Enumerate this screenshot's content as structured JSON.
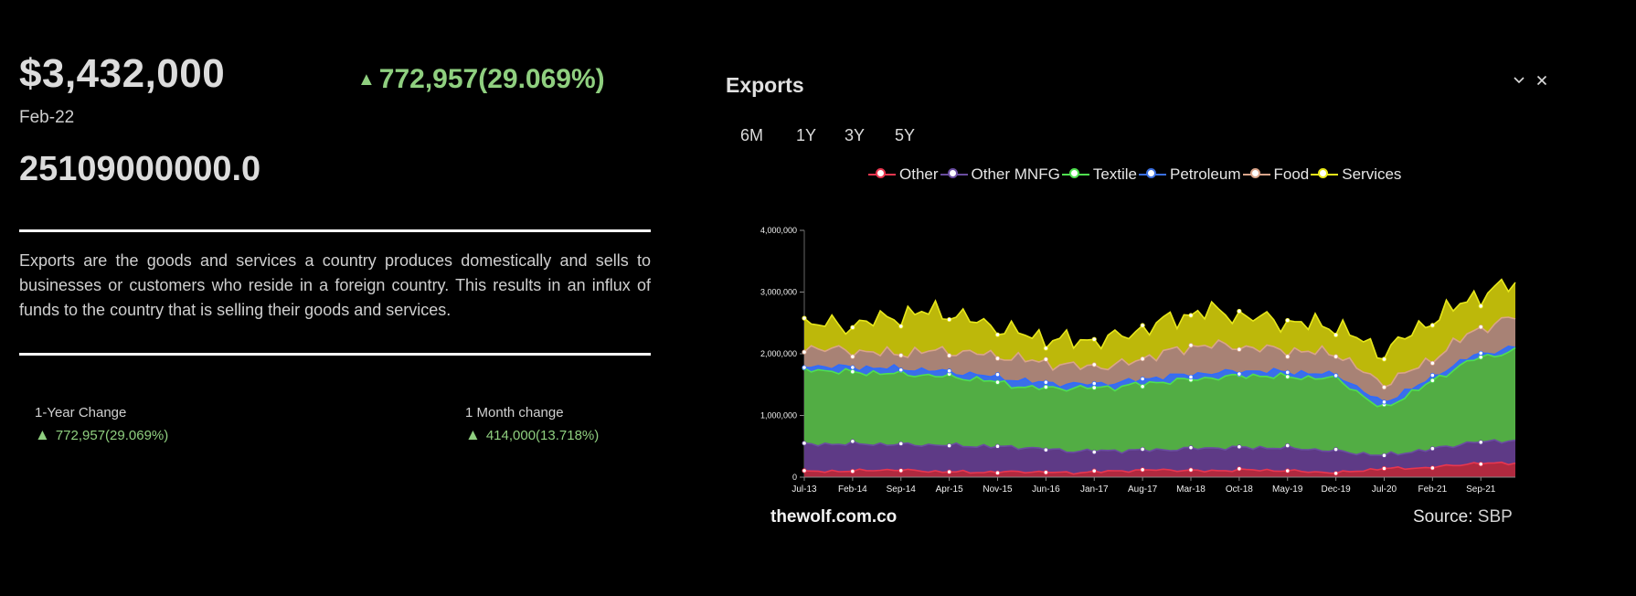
{
  "header": {
    "price": "$3,432,000",
    "change_arrow": "▲",
    "change_text": "772,957(29.069%)",
    "date": "Feb-22",
    "total": "25109000000.0"
  },
  "description": "Exports are the goods and services a country produces domestically and sells to businesses or customers who reside in a foreign country. This results in an influx of funds to the country that is selling their goods and services.",
  "stats": [
    {
      "label": "1-Year Change",
      "arrow": "▲",
      "value": "772,957(29.069%)"
    },
    {
      "label": "1 Month change",
      "arrow": "▲",
      "value": "414,000(13.718%)"
    }
  ],
  "panel": {
    "title": "Exports",
    "icons": [
      "chevron-down-icon",
      "close-icon"
    ],
    "ranges": [
      "6M",
      "1Y",
      "3Y",
      "5Y"
    ],
    "brand": "thewolf.com.co",
    "source_label": "Source:",
    "source_value": "SBP"
  },
  "legend": [
    {
      "name": "Other",
      "color": "#e8364f"
    },
    {
      "name": "Other MNFG",
      "color": "#6a4da0"
    },
    {
      "name": "Textile",
      "color": "#4fe04f"
    },
    {
      "name": "Petroleum",
      "color": "#3a6fe0"
    },
    {
      "name": "Food",
      "color": "#d9a48a"
    },
    {
      "name": "Services",
      "color": "#e8e81a"
    }
  ],
  "chart_data": {
    "type": "area",
    "stacked": true,
    "ylim": [
      0,
      4000000
    ],
    "yticks": [
      0,
      1000000,
      2000000,
      3000000,
      4000000
    ],
    "ytick_labels": [
      "0",
      "1,000,000",
      "2,000,000",
      "3,000,000",
      "4,000,000"
    ],
    "xtick_labels": [
      "Jul-13",
      "Feb-14",
      "Sep-14",
      "Apr-15",
      "Nov-15",
      "Jun-16",
      "Jan-17",
      "Aug-17",
      "Mar-18",
      "Oct-18",
      "May-19",
      "Dec-19",
      "Jul-20",
      "Feb-21",
      "Sep-21"
    ],
    "xtick_index": [
      0,
      7,
      14,
      21,
      28,
      35,
      42,
      49,
      56,
      63,
      70,
      77,
      84,
      91,
      98
    ],
    "x_start": "Jul-13",
    "x_end": "Feb-22",
    "n_points": 104,
    "cumulative_anchors": [
      {
        "name": "Other",
        "values": [
          90000,
          100000,
          120000,
          90000,
          80000,
          90000,
          70000,
          100000,
          120000,
          100000,
          120000,
          100000,
          70000,
          140000,
          150000,
          220000,
          230000
        ]
      },
      {
        "name": "Other MNFG",
        "values": [
          530000,
          540000,
          530000,
          520000,
          500000,
          480000,
          420000,
          430000,
          440000,
          470000,
          480000,
          470000,
          420000,
          350000,
          440000,
          560000,
          600000
        ]
      },
      {
        "name": "Textile",
        "values": [
          1750000,
          1700000,
          1680000,
          1640000,
          1580000,
          1450000,
          1440000,
          1460000,
          1540000,
          1600000,
          1650000,
          1620000,
          1600000,
          1100000,
          1500000,
          1900000,
          2050000
        ]
      },
      {
        "name": "Petroleum",
        "values": [
          1800000,
          1780000,
          1760000,
          1720000,
          1650000,
          1550000,
          1500000,
          1520000,
          1620000,
          1680000,
          1720000,
          1700000,
          1650000,
          1200000,
          1550000,
          1960000,
          2100000
        ]
      },
      {
        "name": "Food",
        "values": [
          2100000,
          2050000,
          2000000,
          2050000,
          2000000,
          1900000,
          1800000,
          1800000,
          2000000,
          2150000,
          2100000,
          2050000,
          2000000,
          1500000,
          1850000,
          2350000,
          2600000
        ]
      },
      {
        "name": "Services",
        "values": [
          2500000,
          2450000,
          2600000,
          2700000,
          2500000,
          2300000,
          2200000,
          2250000,
          2500000,
          2700000,
          2600000,
          2500000,
          2450000,
          2000000,
          2500000,
          2900000,
          3150000
        ]
      }
    ]
  }
}
